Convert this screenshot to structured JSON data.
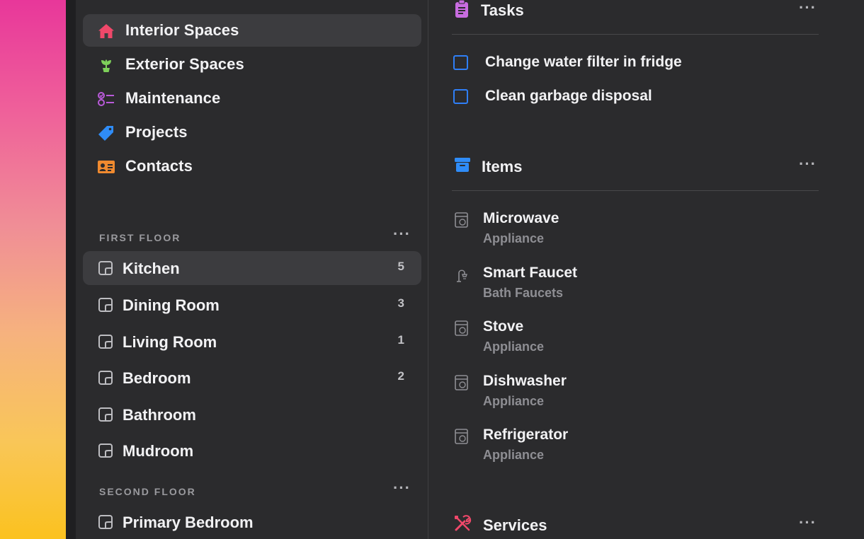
{
  "colors": {
    "home_icon": "#f0486a",
    "exterior_icon": "#7ed05a",
    "maintenance_icon": "#b95ad9",
    "projects_icon": "#2f8cf7",
    "contacts_icon": "#f08a2f",
    "tasks_icon": "#c86ce0",
    "items_icon": "#2f8cf7",
    "services_icon": "#f0486a",
    "checkbox": "#2f7ff7"
  },
  "sidebar": {
    "top_items": [
      {
        "label": "Interior Spaces",
        "icon": "house-icon",
        "selected": true
      },
      {
        "label": "Exterior Spaces",
        "icon": "plant-icon",
        "selected": false
      },
      {
        "label": "Maintenance",
        "icon": "checklist-icon",
        "selected": false
      },
      {
        "label": "Projects",
        "icon": "tag-icon",
        "selected": false
      },
      {
        "label": "Contacts",
        "icon": "contact-card-icon",
        "selected": false
      }
    ],
    "first_floor": {
      "header": "FIRST FLOOR",
      "more": "···",
      "rooms": [
        {
          "label": "Kitchen",
          "count": "5",
          "selected": true
        },
        {
          "label": "Dining Room",
          "count": "3"
        },
        {
          "label": "Living Room",
          "count": "1"
        },
        {
          "label": "Bedroom",
          "count": "2"
        },
        {
          "label": "Bathroom",
          "count": ""
        },
        {
          "label": "Mudroom",
          "count": ""
        }
      ]
    },
    "second_floor": {
      "header": "SECOND FLOOR",
      "more": "···",
      "rooms": [
        {
          "label": "Primary Bedroom",
          "count": ""
        }
      ]
    }
  },
  "detail": {
    "tasks": {
      "title": "Tasks",
      "more": "···",
      "items": [
        {
          "label": "Change water filter in fridge",
          "checked": false
        },
        {
          "label": "Clean garbage disposal",
          "checked": false
        }
      ]
    },
    "items": {
      "title": "Items",
      "more": "···",
      "list": [
        {
          "name": "Microwave",
          "category": "Appliance",
          "icon": "appliance-icon"
        },
        {
          "name": "Smart Faucet",
          "category": "Bath Faucets",
          "icon": "faucet-icon"
        },
        {
          "name": "Stove",
          "category": "Appliance",
          "icon": "appliance-icon"
        },
        {
          "name": "Dishwasher",
          "category": "Appliance",
          "icon": "appliance-icon"
        },
        {
          "name": "Refrigerator",
          "category": "Appliance",
          "icon": "appliance-icon"
        }
      ]
    },
    "services": {
      "title": "Services",
      "more": "···"
    }
  }
}
